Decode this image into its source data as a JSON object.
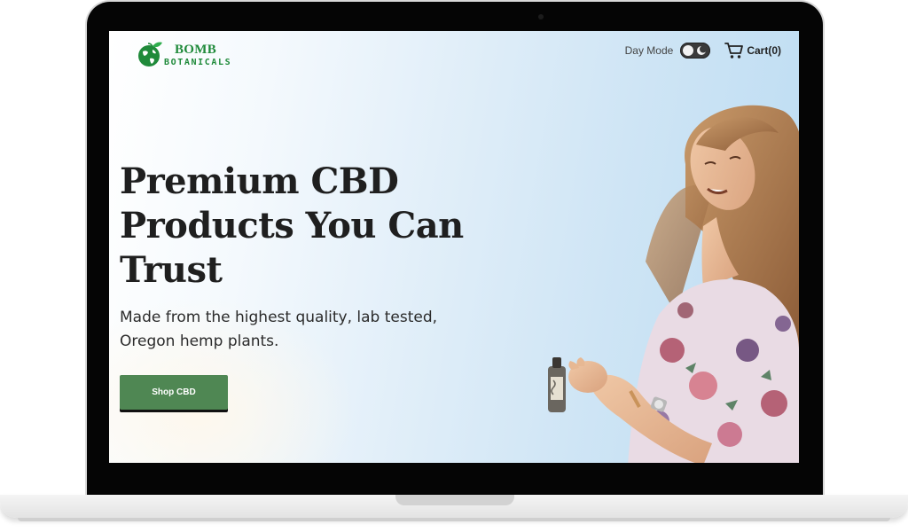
{
  "brand": {
    "logo_line_1": "BOMB",
    "logo_line_2": "BOTANICALS",
    "color": "#1f8a3a"
  },
  "header": {
    "day_mode_label": "Day Mode",
    "cart_label": "Cart(0)"
  },
  "hero": {
    "title": "Premium CBD Products You Can Trust",
    "subtitle": "Made from the highest quality, lab tested, Oregon hemp plants.",
    "cta_label": "Shop CBD",
    "cta_color": "#4f8753"
  },
  "icons": [
    "globe-leaf-logo-icon",
    "moon-icon",
    "cart-icon"
  ]
}
